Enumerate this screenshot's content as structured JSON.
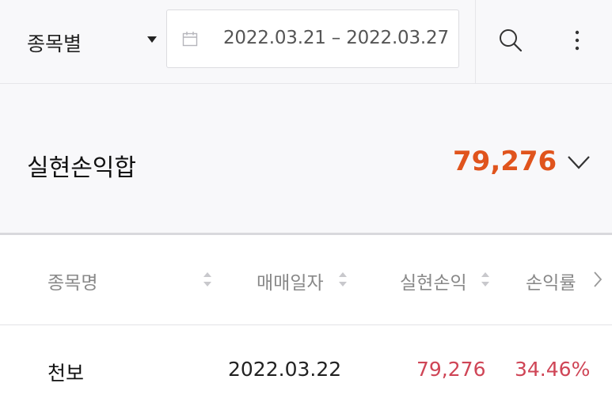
{
  "filter": {
    "selected": "종목별",
    "icon": "caret-down-icon"
  },
  "date_range": {
    "text": "2022.03.21 – 2022.03.27",
    "icon": "calendar-icon"
  },
  "actions": {
    "search_icon": "search-icon",
    "more_icon": "more-vertical-icon"
  },
  "summary": {
    "title": "실현손익합",
    "value": "79,276",
    "value_color": "#e0541d",
    "toggle_icon": "chevron-down-icon"
  },
  "table": {
    "columns": [
      {
        "label": "종목명"
      },
      {
        "label": "매매일자"
      },
      {
        "label": "실현손익"
      },
      {
        "label": "손익률"
      }
    ],
    "rows": [
      {
        "name": "천보",
        "date": "2022.03.22",
        "pnl": "79,276",
        "rate": "34.46%"
      }
    ],
    "positive_color": "#cf4556"
  }
}
